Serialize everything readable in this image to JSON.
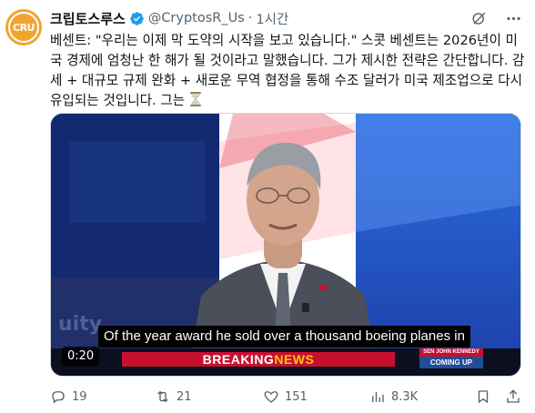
{
  "author": {
    "avatar_text": "CRU",
    "display_name": "크립토스루스",
    "handle": "@CryptosR_Us",
    "separator": "·",
    "time": "1시간"
  },
  "tweet": {
    "text": "베센트: \"우리는 이제 막 도약의 시작을 보고 있습니다.\" 스콧 베센트는 2026년이 미국 경제에 엄청난 한 해가 될 것이라고 말했습니다. 그가 제시한 전략은 간단합니다. 감세 + 대규모 규제 완화 + 새로운 무역 협정을 통해 수조 달러가 미국 제조업으로 다시 유입되는 것입니다. 그는",
    "trailing_emoji": "hourglass-icon"
  },
  "video": {
    "subtitle": "Of the year award he sold over a thousand boeing planes in",
    "banner_left": "BREAKING ",
    "banner_right": "NEWS",
    "nameplate_top": "SEN JOHN KENNEDY",
    "nameplate_bottom": "COMING UP",
    "timestamp": "0:20"
  },
  "actions": {
    "replies": "19",
    "reposts": "21",
    "likes": "151",
    "views": "8.3K"
  },
  "colors": {
    "verified": "#1d9bf0",
    "avatar": "#f0a531",
    "muted": "#536471",
    "breaking_red": "#c8102e",
    "news_yellow": "#ffc20e"
  }
}
